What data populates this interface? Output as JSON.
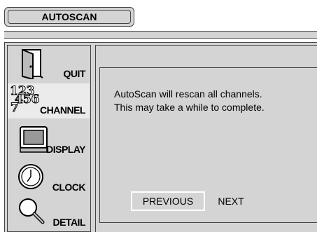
{
  "header": {
    "title": "AUTOSCAN"
  },
  "sidebar": {
    "items": [
      {
        "label": "QUIT",
        "icon": "door-icon",
        "selected": false
      },
      {
        "label": "CHANNEL",
        "icon": "channel-numbers-icon",
        "selected": true
      },
      {
        "label": "DISPLAY",
        "icon": "monitor-icon",
        "selected": false
      },
      {
        "label": "CLOCK",
        "icon": "clock-icon",
        "selected": false
      },
      {
        "label": "DETAIL",
        "icon": "magnifier-icon",
        "selected": false
      }
    ]
  },
  "dialog": {
    "line1": "AutoScan will rescan all channels.",
    "line2": "This may take a while to complete.",
    "previous_label": "PREVIOUS",
    "next_label": "NEXT",
    "focused_button": "PREVIOUS"
  },
  "colors": {
    "panel": "#d4d4d4",
    "selected": "#ebebeb",
    "border": "#444444",
    "focus": "#ffffff"
  }
}
